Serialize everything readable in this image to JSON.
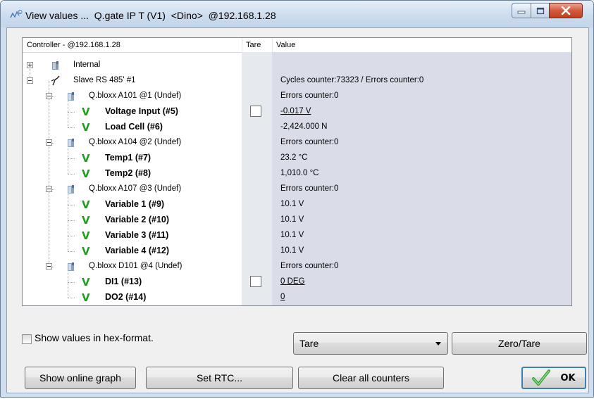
{
  "window": {
    "title": "View values ...  Q.gate IP T (V1)  <Dino>  @192.168.1.28",
    "controls": {
      "minimize": "min",
      "maximize": "max",
      "close": "x"
    }
  },
  "tree": {
    "columns": {
      "controller": "Controller - @192.168.1.28",
      "tare": "Tare",
      "value": "Value"
    },
    "rows": [
      {
        "label": "Internal",
        "value": ""
      },
      {
        "label": "Slave RS 485' #1",
        "value": "Cycles counter:73323 / Errors counter:0"
      },
      {
        "label": "Q.bloxx A101 @1 (Undef)",
        "value": "Errors counter:0"
      },
      {
        "label": "Voltage Input (#5)",
        "value": "-0.017 V",
        "tare": false
      },
      {
        "label": "Load Cell (#6)",
        "value": "-2,424.000 N"
      },
      {
        "label": "Q.bloxx A104 @2 (Undef)",
        "value": "Errors counter:0"
      },
      {
        "label": "Temp1 (#7)",
        "value": "23.2 °C"
      },
      {
        "label": "Temp2 (#8)",
        "value": "1,010.0 °C"
      },
      {
        "label": "Q.bloxx A107 @3 (Undef)",
        "value": "Errors counter:0"
      },
      {
        "label": "Variable 1 (#9)",
        "value": "10.1 V"
      },
      {
        "label": "Variable 2 (#10)",
        "value": "10.1 V"
      },
      {
        "label": "Variable 3 (#11)",
        "value": "10.1 V"
      },
      {
        "label": "Variable 4 (#12)",
        "value": "10.1 V"
      },
      {
        "label": "Q.bloxx D101 @4 (Undef)",
        "value": "Errors counter:0"
      },
      {
        "label": "DI1 (#13)",
        "value": "0 DEG",
        "tare": false
      },
      {
        "label": "DO2 (#14)",
        "value": "0"
      }
    ],
    "channel_mark": "V"
  },
  "options": {
    "hex_format_label": "Show values in hex-format.",
    "hex_format_checked": false,
    "tare_select_value": "Tare",
    "zero_tare_label": "Zero/Tare"
  },
  "buttons": {
    "online_graph": "Show online graph",
    "set_rtc": "Set RTC...",
    "clear_counters": "Clear all counters",
    "ok": "OK"
  },
  "colors": {
    "value_column": "#dadde8",
    "channel_mark": "#1f9e1f",
    "titlebar": "#cddcee"
  }
}
